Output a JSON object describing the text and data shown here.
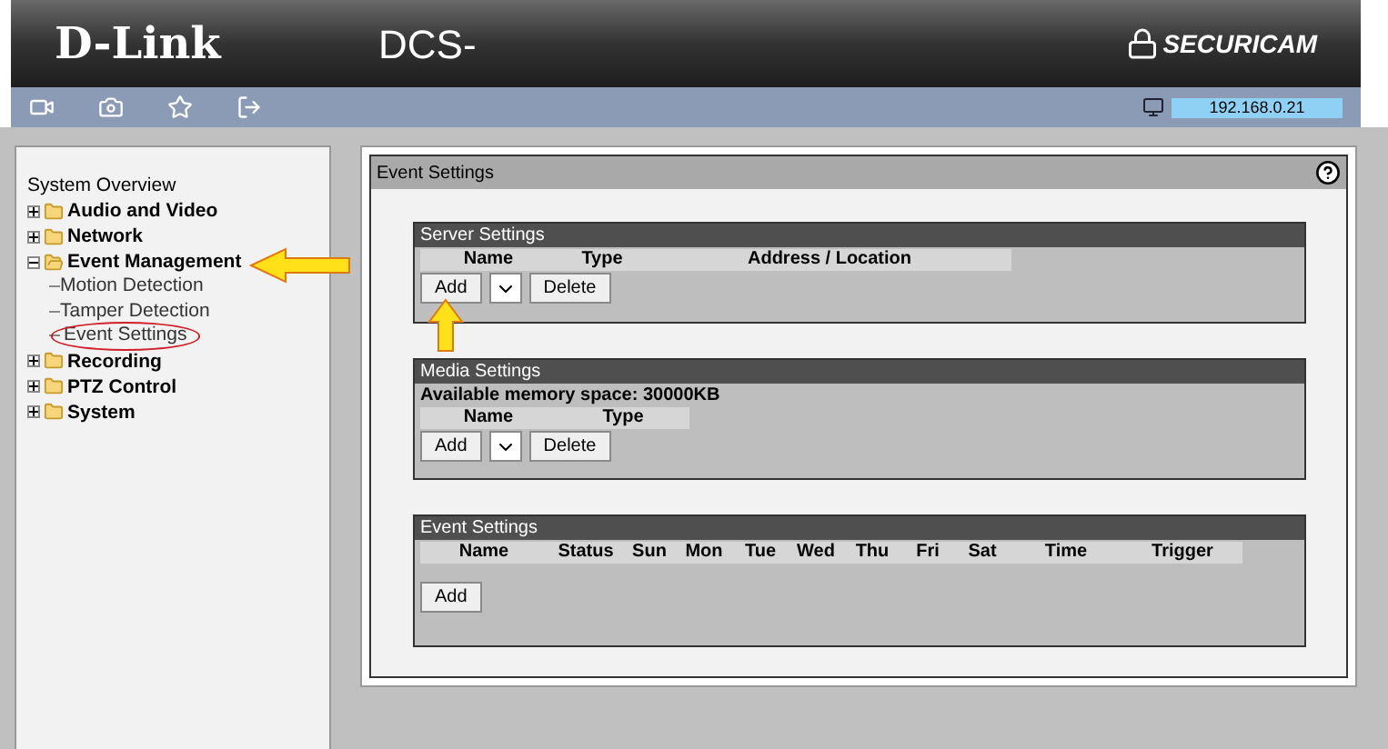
{
  "header": {
    "brand": "D-Link",
    "model": "DCS-",
    "logo": "SECURICAM"
  },
  "toolbar": {
    "ip_address": "192.168.0.21"
  },
  "sidebar": {
    "title": "System Overview",
    "items": [
      {
        "label": "Audio and Video",
        "expanded": false
      },
      {
        "label": "Network",
        "expanded": false
      },
      {
        "label": "Event Management",
        "expanded": true,
        "children": [
          {
            "label": "Motion Detection",
            "highlighted": false
          },
          {
            "label": "Tamper Detection",
            "highlighted": false
          },
          {
            "label": "Event Settings",
            "highlighted": true
          }
        ]
      },
      {
        "label": "Recording",
        "expanded": false
      },
      {
        "label": "PTZ Control",
        "expanded": false
      },
      {
        "label": "System",
        "expanded": false
      }
    ]
  },
  "panel": {
    "title": "Event Settings",
    "sections": [
      {
        "title": "Server Settings",
        "columns": [
          "Name",
          "Type",
          "Address / Location"
        ],
        "buttons": [
          {
            "kind": "button",
            "label": "Add"
          },
          {
            "kind": "select"
          },
          {
            "kind": "button",
            "label": "Delete"
          }
        ]
      },
      {
        "title": "Media Settings",
        "info": "Available memory space: 30000KB",
        "columns": [
          "Name",
          "Type"
        ],
        "buttons": [
          {
            "kind": "button",
            "label": "Add"
          },
          {
            "kind": "select"
          },
          {
            "kind": "button",
            "label": "Delete"
          }
        ]
      },
      {
        "title": "Event Settings",
        "columns": [
          "Name",
          "Status",
          "Sun",
          "Mon",
          "Tue",
          "Wed",
          "Thu",
          "Fri",
          "Sat",
          "Time",
          "Trigger"
        ],
        "buttons": [
          {
            "kind": "button",
            "label": "Add"
          }
        ]
      }
    ]
  }
}
